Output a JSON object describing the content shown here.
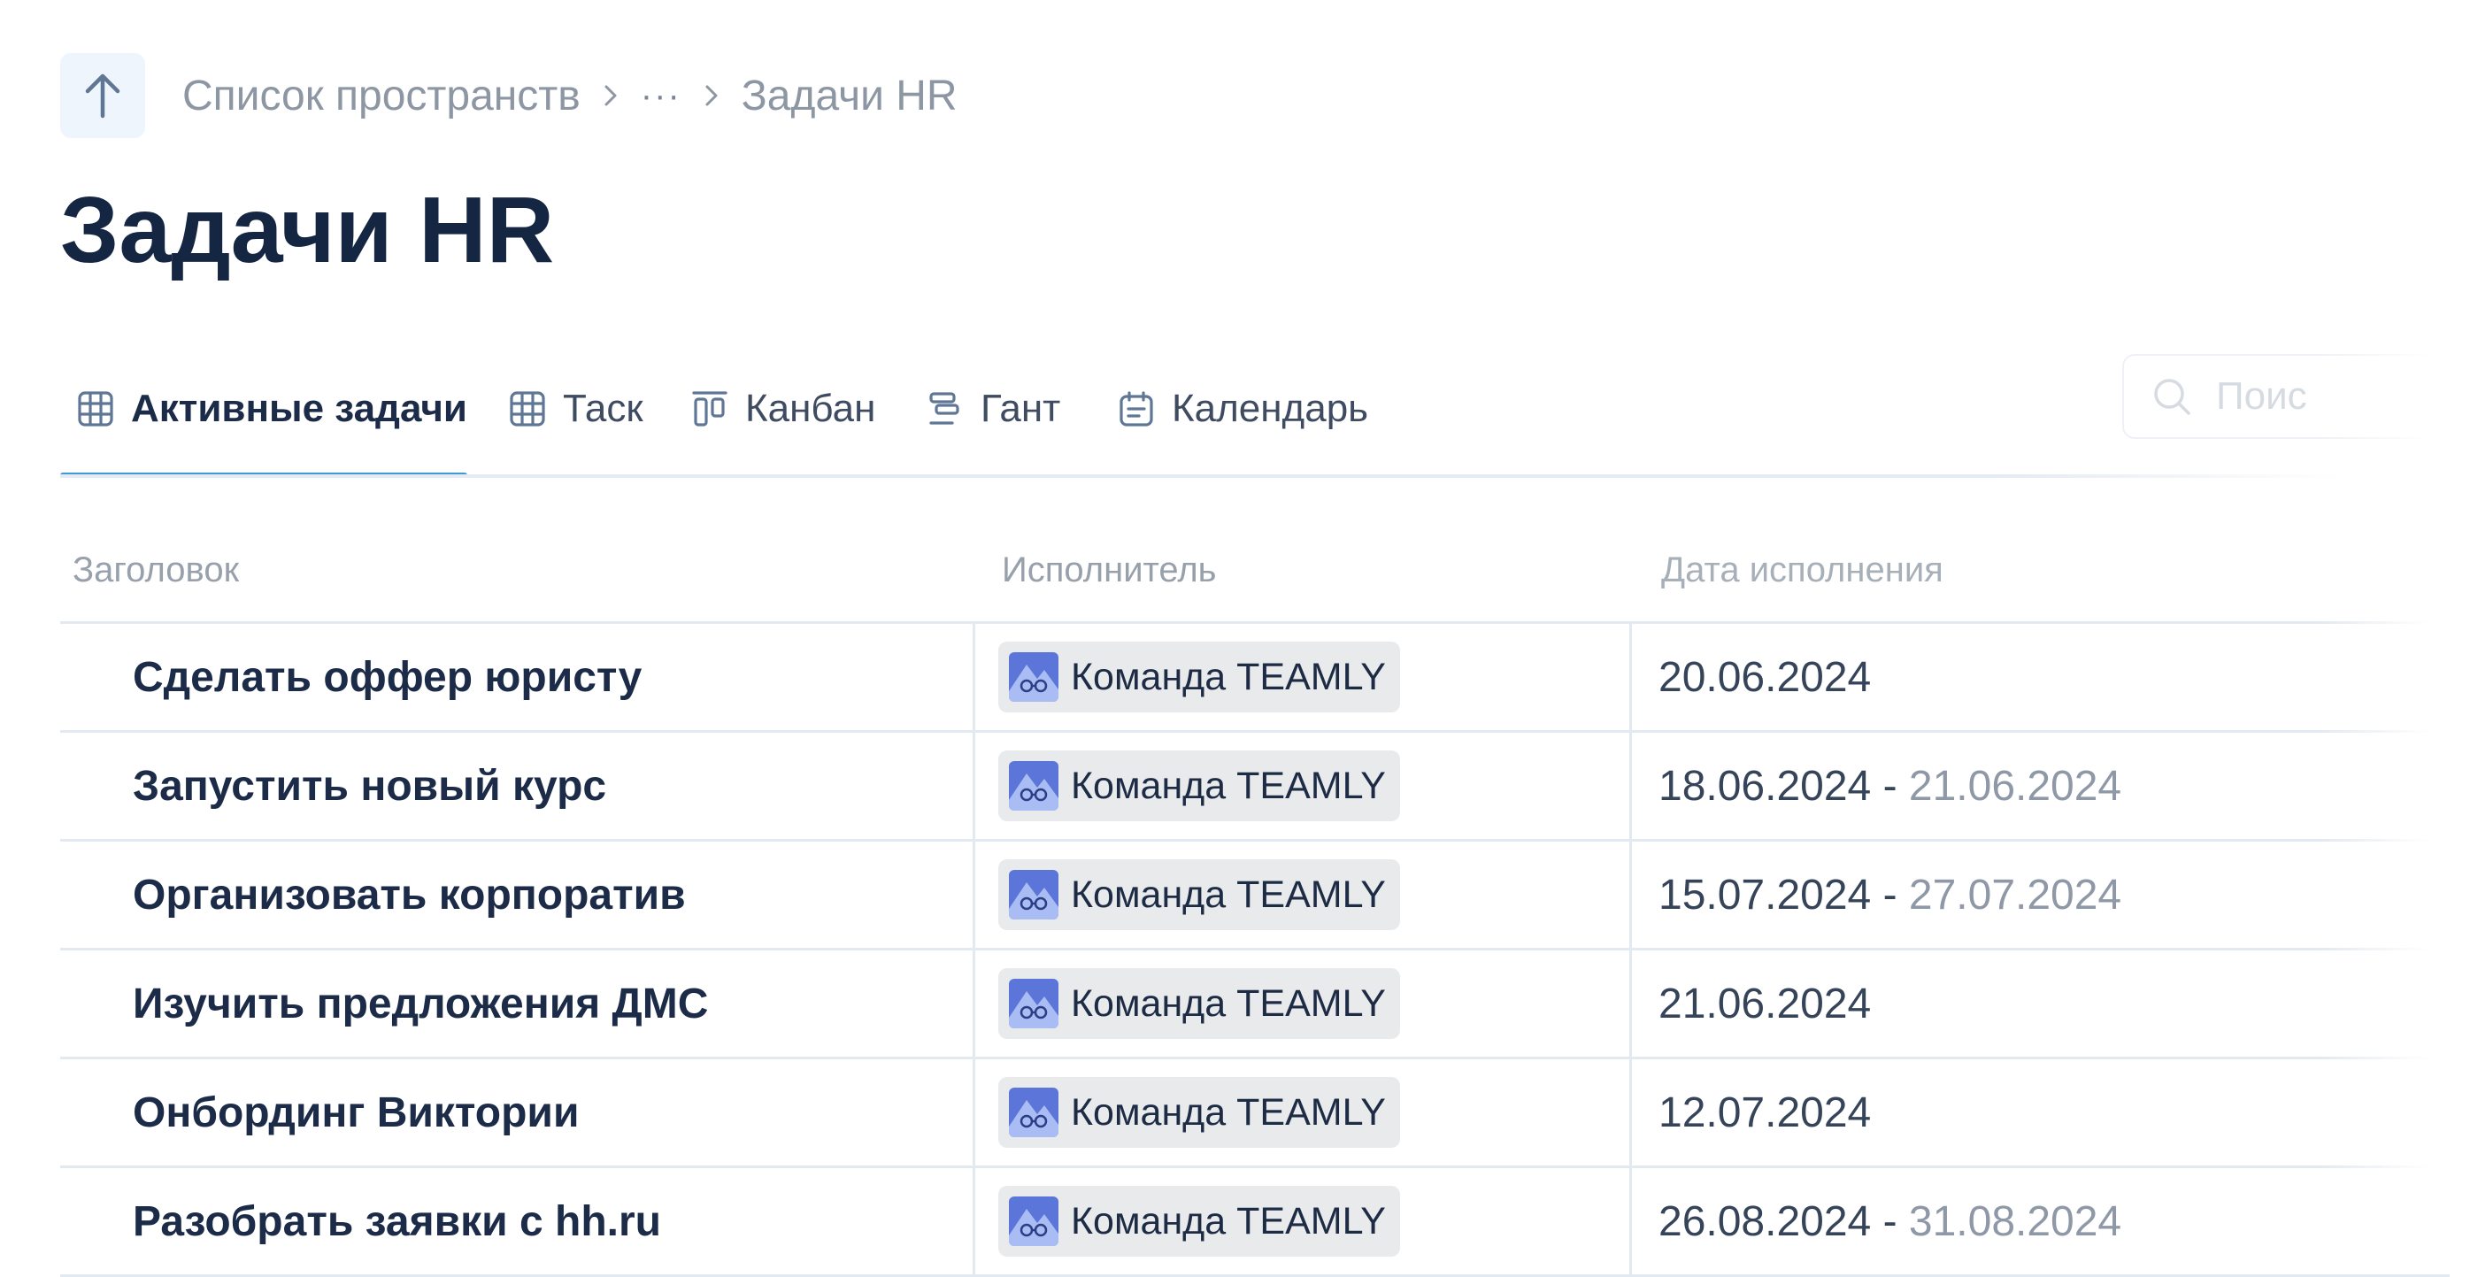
{
  "breadcrumb": {
    "spaces_label": "Список пространств",
    "ellipsis": "···",
    "current": "Задачи HR"
  },
  "page": {
    "title": "Задачи HR"
  },
  "tabs": [
    {
      "label": "Активные задачи",
      "icon": "table-grid-icon",
      "active": true
    },
    {
      "label": "Таск",
      "icon": "table-grid-icon",
      "active": false
    },
    {
      "label": "Канбан",
      "icon": "kanban-icon",
      "active": false
    },
    {
      "label": "Гант",
      "icon": "gantt-icon",
      "active": false
    },
    {
      "label": "Календарь",
      "icon": "calendar-icon",
      "active": false
    }
  ],
  "search": {
    "placeholder": "Поис",
    "icon": "search-icon"
  },
  "table": {
    "columns": [
      "Заголовок",
      "Исполнитель",
      "Дата исполнения"
    ],
    "rows": [
      {
        "title": "Сделать оффер юристу",
        "assignee": "Команда TEAMLY",
        "date_start": "20.06.2024",
        "date_sep": "",
        "date_end": ""
      },
      {
        "title": "Запустить новый курс",
        "assignee": "Команда TEAMLY",
        "date_start": "18.06.2024",
        "date_sep": " - ",
        "date_end": "21.06.2024"
      },
      {
        "title": "Организовать корпоратив",
        "assignee": "Команда TEAMLY",
        "date_start": "15.07.2024",
        "date_sep": " - ",
        "date_end": "27.07.2024"
      },
      {
        "title": "Изучить предложения ДМС",
        "assignee": "Команда TEAMLY",
        "date_start": "21.06.2024",
        "date_sep": "",
        "date_end": ""
      },
      {
        "title": "Онбординг Виктории",
        "assignee": "Команда TEAMLY",
        "date_start": "12.07.2024",
        "date_sep": "",
        "date_end": ""
      },
      {
        "title": "Разобрать заявки с hh.ru",
        "assignee": "Команда TEAMLY",
        "date_start": "26.08.2024",
        "date_sep": " - ",
        "date_end": "31.08.2024"
      }
    ]
  },
  "colors": {
    "accent": "#3e9ad6",
    "title_text": "#152642",
    "chip_bg": "#e8eaec",
    "avatar_bg": "#5b76d8"
  }
}
